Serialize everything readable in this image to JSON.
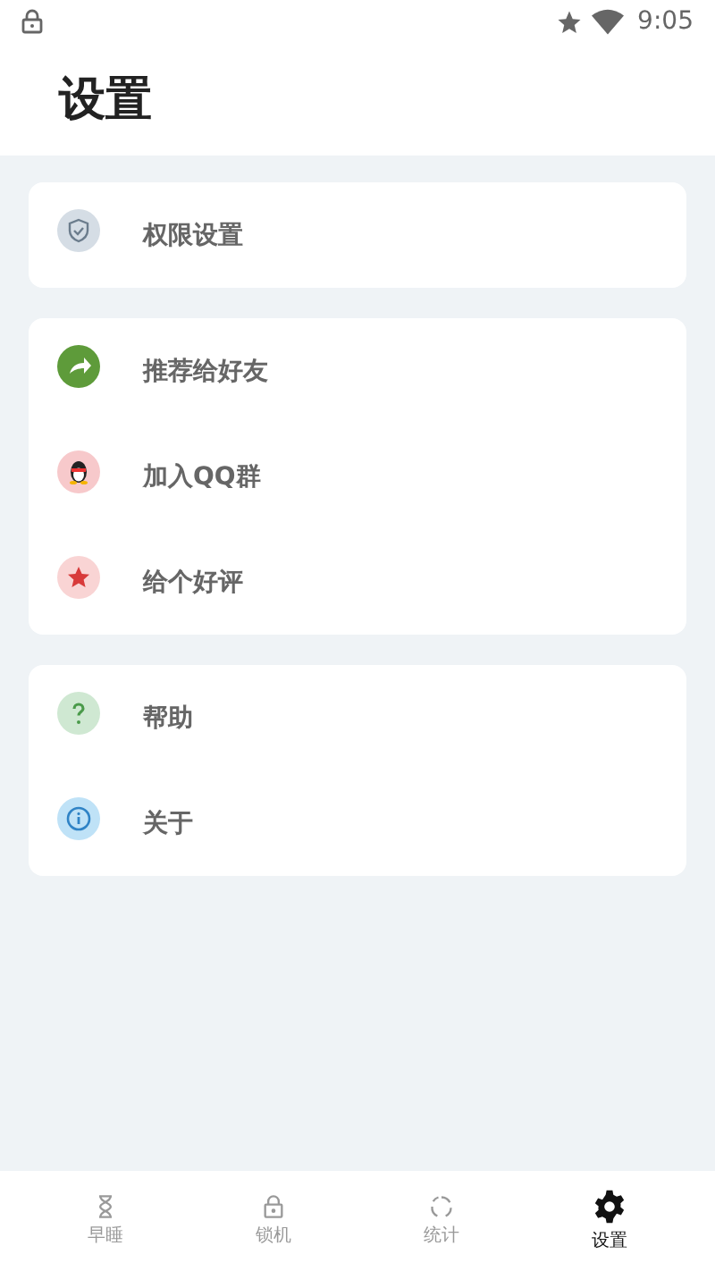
{
  "status_bar": {
    "time": "9:05"
  },
  "title": "设置",
  "groups": [
    {
      "items": [
        {
          "kind": "shield",
          "label": "权限设置"
        }
      ]
    },
    {
      "items": [
        {
          "kind": "share",
          "label": "推荐给好友"
        },
        {
          "kind": "penguin",
          "label": "加入QQ群"
        },
        {
          "kind": "star",
          "label": "给个好评"
        }
      ]
    },
    {
      "items": [
        {
          "kind": "help",
          "label": "帮助"
        },
        {
          "kind": "info",
          "label": "关于"
        }
      ]
    }
  ],
  "nav": [
    {
      "kind": "hourglass",
      "label": "早睡",
      "selected": false
    },
    {
      "kind": "lock",
      "label": "锁机",
      "selected": false
    },
    {
      "kind": "ring",
      "label": "统计",
      "selected": false
    },
    {
      "kind": "gear",
      "label": "设置",
      "selected": true
    }
  ]
}
